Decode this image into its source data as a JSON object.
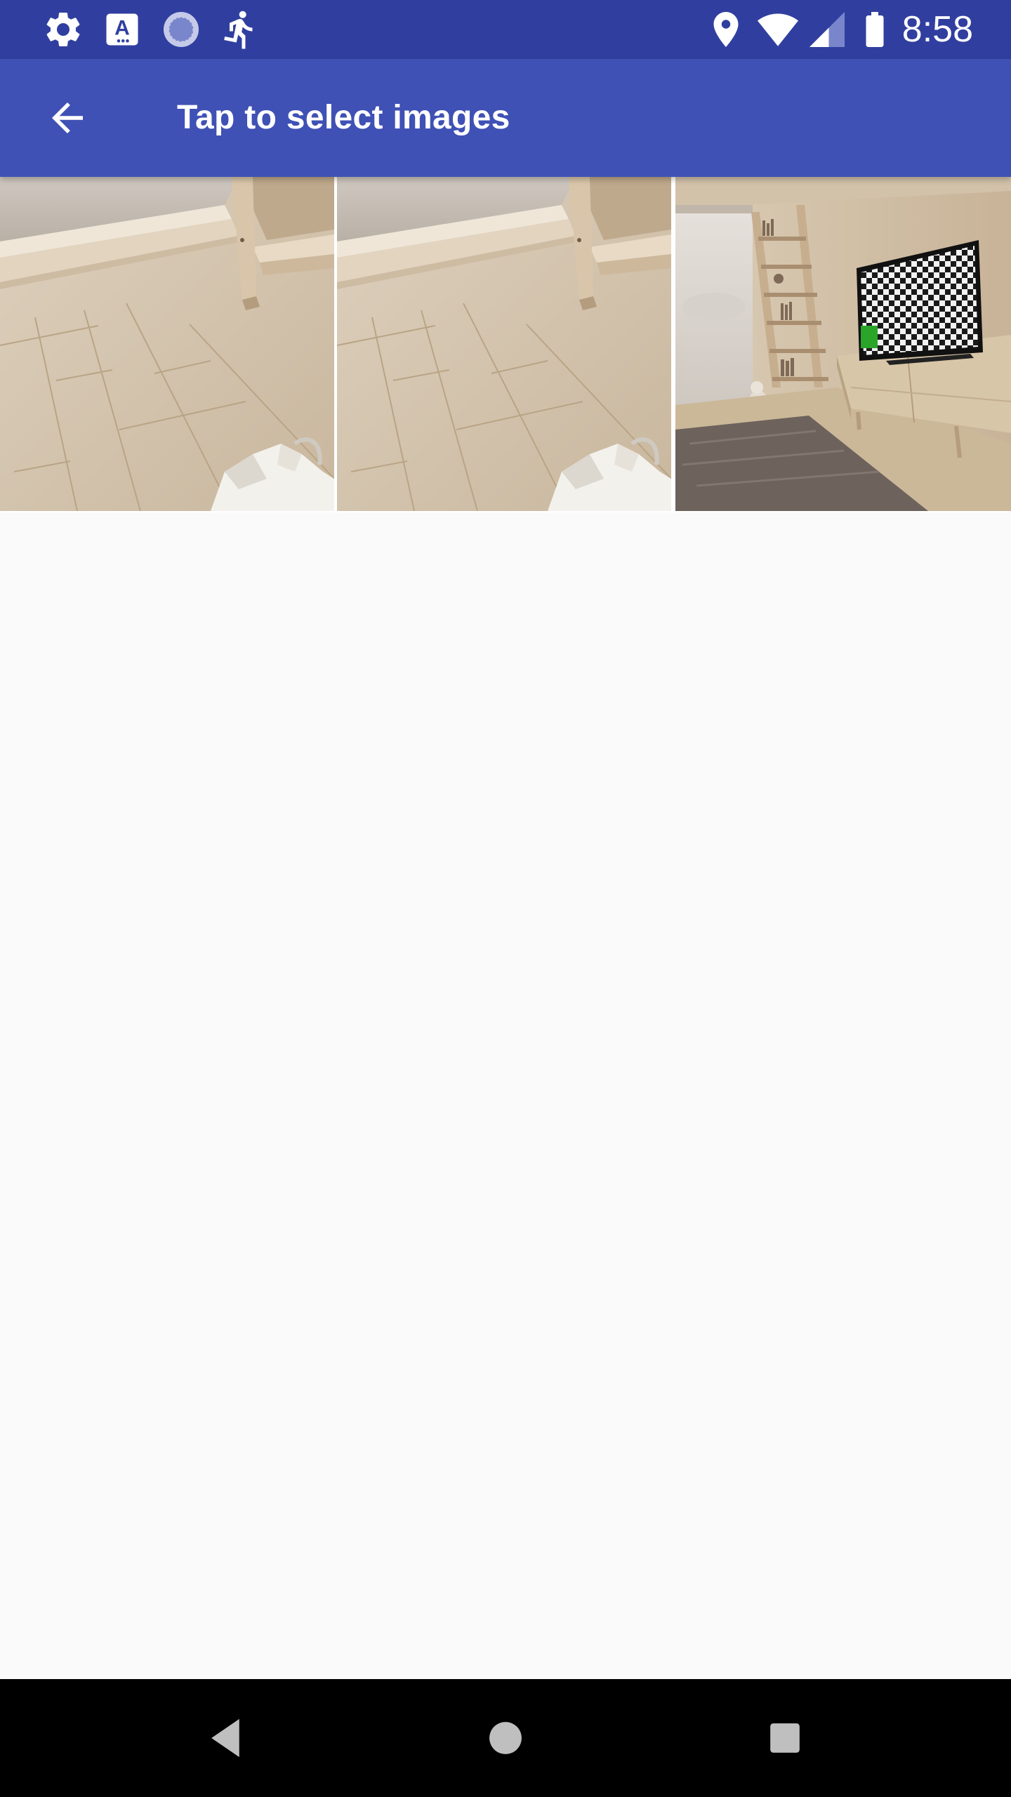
{
  "status_bar": {
    "time": "8:58",
    "left_icons": [
      "settings-icon",
      "keyboard-a-icon",
      "sync-circle-icon",
      "running-icon"
    ],
    "right_icons": [
      "location-icon",
      "wifi-icon",
      "cellular-signal-icon",
      "battery-icon"
    ],
    "background_color": "#303f9f"
  },
  "app_bar": {
    "title": "Tap to select images",
    "back_icon": "arrow-back-icon",
    "background_color": "#3f51b5"
  },
  "gallery": {
    "items": [
      {
        "name": "wooden-floor-room-photo"
      },
      {
        "name": "wooden-floor-room-photo"
      },
      {
        "name": "living-room-tv-checkerboard-photo"
      }
    ]
  },
  "navigation_bar": {
    "buttons": [
      "back-triangle-icon",
      "home-circle-icon",
      "recents-square-icon"
    ],
    "background_color": "#000000"
  }
}
